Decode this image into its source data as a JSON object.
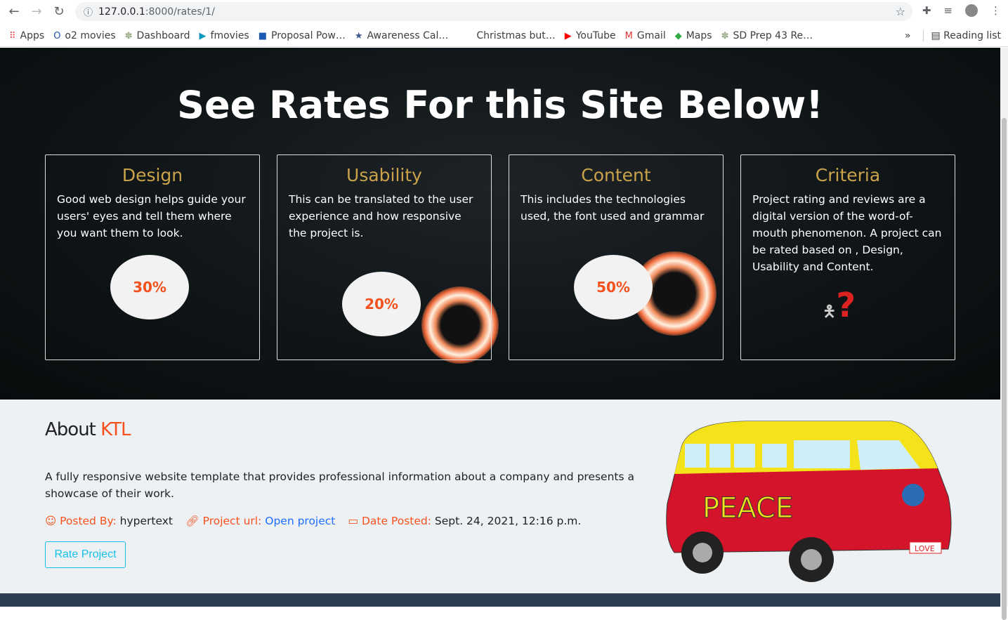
{
  "browser": {
    "url_host": "127.0.0.1",
    "url_path": ":8000/rates/1/",
    "bookmarks": [
      {
        "label": "Apps",
        "icon": "apps-grid-icon"
      },
      {
        "label": "o2 movies",
        "icon": "o2-icon"
      },
      {
        "label": "Dashboard",
        "icon": "tree-icon"
      },
      {
        "label": "fmovies",
        "icon": "play-icon"
      },
      {
        "label": "Proposal Pow…",
        "icon": "proposal-icon"
      },
      {
        "label": "Awareness Cal…",
        "icon": "star-icon"
      },
      {
        "label": "Christmas but…",
        "icon": ""
      },
      {
        "label": "YouTube",
        "icon": "youtube-icon"
      },
      {
        "label": "Gmail",
        "icon": "gmail-icon"
      },
      {
        "label": "Maps",
        "icon": "maps-icon"
      },
      {
        "label": "SD Prep 43 Re…",
        "icon": "tree-icon"
      }
    ],
    "more": "»",
    "reading_list": "Reading list"
  },
  "hero": {
    "title": "See Rates For this Site Below!",
    "cards": [
      {
        "title": "Design",
        "text": "Good web design helps guide your users' eyes and tell them where you want them to look.",
        "rating": "30%"
      },
      {
        "title": "Usability",
        "text": "This can be translated to the user experience and how responsive the project is.",
        "rating": "20%"
      },
      {
        "title": "Content",
        "text": "This includes the technologies used, the font used and grammar",
        "rating": "50%"
      },
      {
        "title": "Criteria",
        "text": "Project rating and reviews are a digital version of the word-of-mouth phenomenon. A project can be rated based on , Design, Usability and Content.",
        "icon": "question-figure-icon"
      }
    ]
  },
  "about": {
    "heading": "About ",
    "name": "KTL",
    "description": "A fully responsive website template that provides professional information about a company and presents a showcase of their work.",
    "posted_by_label": "Posted By:",
    "posted_by": "hypertext",
    "url_label": "Project url:",
    "url_link": "Open project",
    "date_label": "Date Posted:",
    "date": "Sept. 24, 2021, 12:16 p.m.",
    "rate_button": "Rate Project",
    "van_text": "PEACE",
    "van_plate": "LOVE"
  },
  "colors": {
    "accent": "#f4511e",
    "card_title": "#c9a24a",
    "button": "#17c1e8",
    "link": "#1e6fff"
  }
}
